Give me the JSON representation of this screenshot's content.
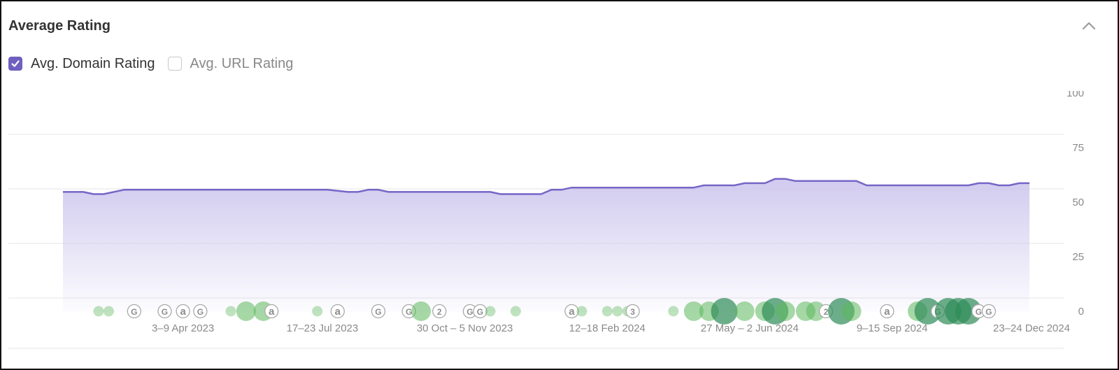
{
  "header": {
    "title": "Average Rating"
  },
  "legend": [
    {
      "label": "Avg. Domain Rating",
      "checked": true
    },
    {
      "label": "Avg. URL Rating",
      "checked": false
    }
  ],
  "colors": {
    "accent": "#6f5fbf",
    "line": "#7766c7",
    "area_top": "#c9c1ec",
    "marker_green": "#5cb85c",
    "marker_dark_green": "#2e8b57",
    "grid": "#e6e6e6",
    "axis_text": "#8a8a8a"
  },
  "chart_data": {
    "type": "area",
    "title": "Average Rating",
    "series": [
      {
        "name": "Avg. Domain Rating",
        "points": [
          [
            0,
            55
          ],
          [
            2,
            55
          ],
          [
            3,
            54
          ],
          [
            4,
            54
          ],
          [
            6,
            56
          ],
          [
            10,
            56
          ],
          [
            20,
            56
          ],
          [
            26,
            56
          ],
          [
            28,
            55
          ],
          [
            29,
            55
          ],
          [
            30,
            56
          ],
          [
            31,
            56
          ],
          [
            32,
            55
          ],
          [
            36,
            55
          ],
          [
            42,
            55
          ],
          [
            43,
            54
          ],
          [
            47,
            54
          ],
          [
            48,
            56
          ],
          [
            49,
            56
          ],
          [
            50,
            57
          ],
          [
            55,
            57
          ],
          [
            62,
            57
          ],
          [
            63,
            58
          ],
          [
            66,
            58
          ],
          [
            67,
            59
          ],
          [
            69,
            59
          ],
          [
            70,
            61
          ],
          [
            71,
            61
          ],
          [
            72,
            60
          ],
          [
            78,
            60
          ],
          [
            79,
            58
          ],
          [
            89,
            58
          ],
          [
            90,
            59
          ],
          [
            91,
            59
          ],
          [
            92,
            58
          ],
          [
            93,
            58
          ],
          [
            94,
            59
          ],
          [
            95,
            59
          ]
        ]
      }
    ],
    "x_ticks": [
      {
        "pos": 11.8,
        "label": "3–9 Apr 2023"
      },
      {
        "pos": 25.5,
        "label": "17–23 Jul 2023"
      },
      {
        "pos": 39.5,
        "label": "30 Oct – 5 Nov 2023"
      },
      {
        "pos": 53.5,
        "label": "12–18 Feb 2024"
      },
      {
        "pos": 67.5,
        "label": "27 May – 2 Jun 2024"
      },
      {
        "pos": 81.5,
        "label": "9–15 Sep 2024"
      },
      {
        "pos": 95.2,
        "label": "23–24 Dec 2024"
      }
    ],
    "y_ticks": [
      0,
      25,
      50,
      75,
      100
    ],
    "ylim": [
      0,
      100
    ],
    "xlim": [
      0,
      95
    ],
    "grid": true,
    "legend_position": "top-left",
    "markers": [
      {
        "pos": 3.5,
        "kind": "dot",
        "size": 1
      },
      {
        "pos": 4.5,
        "kind": "dot",
        "size": 1
      },
      {
        "pos": 7,
        "kind": "google",
        "label": "G"
      },
      {
        "pos": 10,
        "kind": "google",
        "label": "G"
      },
      {
        "pos": 11.8,
        "kind": "amazon",
        "label": "a"
      },
      {
        "pos": 13.5,
        "kind": "google",
        "label": "G"
      },
      {
        "pos": 16.5,
        "kind": "dot",
        "size": 1
      },
      {
        "pos": 18,
        "kind": "dot",
        "size": 2
      },
      {
        "pos": 19.7,
        "kind": "dot",
        "size": 2
      },
      {
        "pos": 20.5,
        "kind": "amazon",
        "label": "a"
      },
      {
        "pos": 25,
        "kind": "dot",
        "size": 1
      },
      {
        "pos": 27,
        "kind": "amazon",
        "label": "a"
      },
      {
        "pos": 31,
        "kind": "google",
        "label": "G"
      },
      {
        "pos": 34,
        "kind": "google",
        "label": "G"
      },
      {
        "pos": 35.2,
        "kind": "dot",
        "size": 2
      },
      {
        "pos": 37,
        "kind": "count",
        "label": "2"
      },
      {
        "pos": 40,
        "kind": "google",
        "label": "G"
      },
      {
        "pos": 41,
        "kind": "google",
        "label": "G"
      },
      {
        "pos": 42,
        "kind": "dot",
        "size": 1
      },
      {
        "pos": 44.5,
        "kind": "dot",
        "size": 1
      },
      {
        "pos": 50,
        "kind": "amazon",
        "label": "a"
      },
      {
        "pos": 51,
        "kind": "dot",
        "size": 1
      },
      {
        "pos": 53.5,
        "kind": "dot",
        "size": 1
      },
      {
        "pos": 54.5,
        "kind": "dot",
        "size": 1
      },
      {
        "pos": 55.5,
        "kind": "dot",
        "size": 1
      },
      {
        "pos": 56,
        "kind": "count",
        "label": "3"
      },
      {
        "pos": 60,
        "kind": "dot",
        "size": 1
      },
      {
        "pos": 62,
        "kind": "dot",
        "size": 2
      },
      {
        "pos": 63.5,
        "kind": "dot",
        "size": 2
      },
      {
        "pos": 65,
        "kind": "dot",
        "size": 3
      },
      {
        "pos": 67,
        "kind": "dot",
        "size": 2
      },
      {
        "pos": 69,
        "kind": "dot",
        "size": 2
      },
      {
        "pos": 70,
        "kind": "dot",
        "size": 3
      },
      {
        "pos": 71,
        "kind": "dot",
        "size": 2
      },
      {
        "pos": 73,
        "kind": "dot",
        "size": 2
      },
      {
        "pos": 74,
        "kind": "dot",
        "size": 2
      },
      {
        "pos": 75,
        "kind": "count",
        "label": "2"
      },
      {
        "pos": 76.5,
        "kind": "dot",
        "size": 3
      },
      {
        "pos": 77.5,
        "kind": "dot",
        "size": 2
      },
      {
        "pos": 81,
        "kind": "amazon",
        "label": "a"
      },
      {
        "pos": 84,
        "kind": "dot",
        "size": 2
      },
      {
        "pos": 85,
        "kind": "dot",
        "size": 3
      },
      {
        "pos": 86,
        "kind": "google",
        "label": "G"
      },
      {
        "pos": 87,
        "kind": "dot",
        "size": 3
      },
      {
        "pos": 88,
        "kind": "dot",
        "size": 3
      },
      {
        "pos": 89,
        "kind": "dot",
        "size": 3
      },
      {
        "pos": 90,
        "kind": "google",
        "label": "G"
      },
      {
        "pos": 91,
        "kind": "google",
        "label": "G"
      }
    ]
  }
}
